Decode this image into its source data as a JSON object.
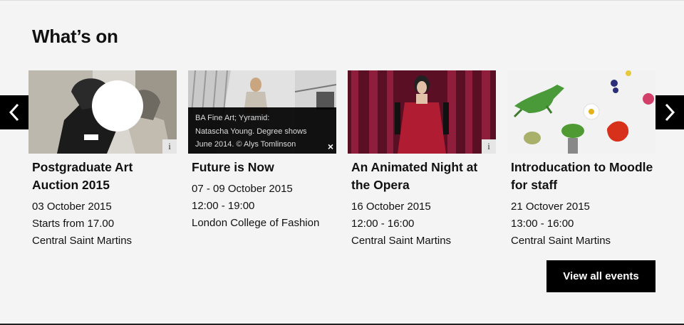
{
  "section": {
    "title": "What’s on"
  },
  "carousel": {
    "prev_icon": "chevron-left-icon",
    "next_icon": "chevron-right-icon"
  },
  "events": [
    {
      "title": "Postgraduate Art Auction 2015",
      "date": "03 October 2015",
      "time": "Starts from 17.00",
      "venue": "Central Saint Martins",
      "info_label": "i"
    },
    {
      "title": "Future is Now",
      "date": "07 - 09 October 2015",
      "time": "12:00 - 19:00",
      "venue": "London College of Fashion",
      "caption": {
        "line1": "BA Fine Art; Yyramid:",
        "line2": "Natascha Young. Degree shows",
        "line3": "June 2014. © Alys Tomlinson",
        "close": "×"
      }
    },
    {
      "title": "An Animated Night at the Opera",
      "date": "16 October 2015",
      "time": "12:00 - 16:00",
      "venue": "Central Saint Martins",
      "info_label": "i"
    },
    {
      "title": "Introducation to Moodle for staff",
      "date": "21 Octover 2015",
      "time": "13:00 - 16:00",
      "venue": "Central Saint Martins"
    }
  ],
  "view_all": "View all events",
  "colors": {
    "background": "#f4f4f4",
    "button": "#000000",
    "text": "#111111"
  }
}
